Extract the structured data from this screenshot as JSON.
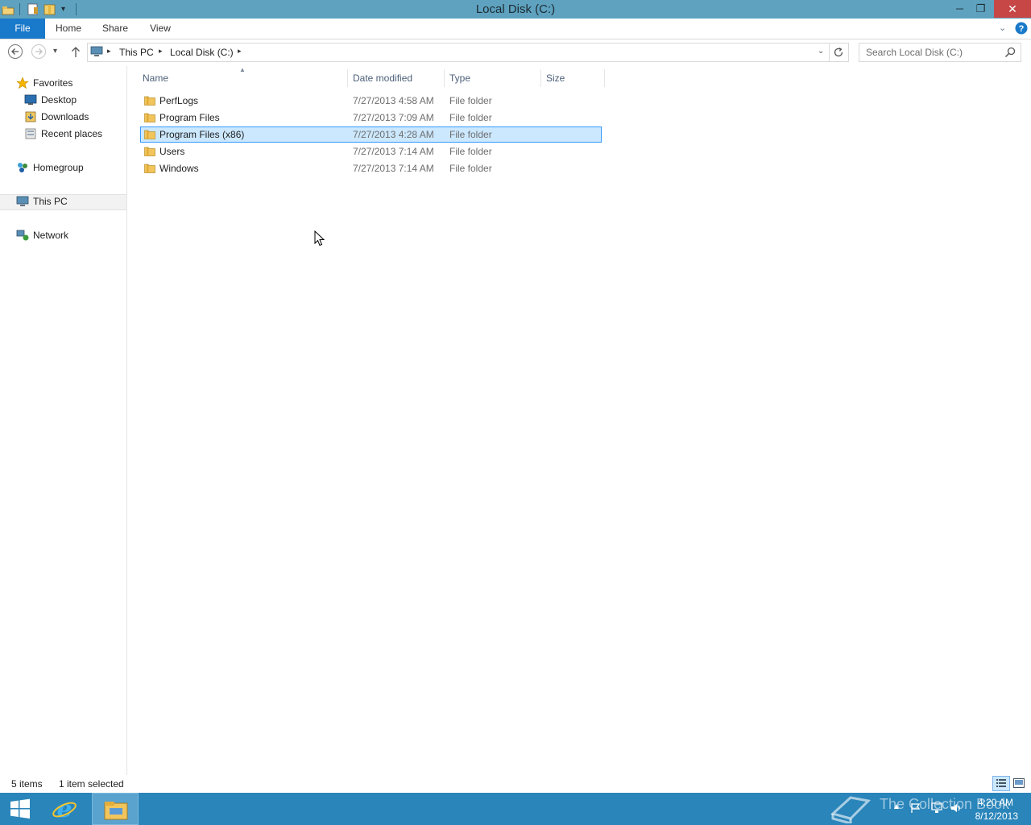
{
  "window": {
    "title": "Local Disk (C:)",
    "minimize_glyph": "─",
    "restore_glyph": "❐",
    "close_glyph": "✕"
  },
  "ribbon": {
    "tabs": [
      "File",
      "Home",
      "Share",
      "View"
    ]
  },
  "address": {
    "breadcrumb": [
      "This PC",
      "Local Disk (C:)"
    ],
    "search_placeholder": "Search Local Disk (C:)"
  },
  "nav": {
    "favorites": "Favorites",
    "favorites_items": [
      "Desktop",
      "Downloads",
      "Recent places"
    ],
    "homegroup": "Homegroup",
    "this_pc": "This PC",
    "network": "Network"
  },
  "columns": {
    "name": "Name",
    "date": "Date modified",
    "type": "Type",
    "size": "Size"
  },
  "files": [
    {
      "name": "PerfLogs",
      "date": "7/27/2013 4:58 AM",
      "type": "File folder",
      "selected": false
    },
    {
      "name": "Program Files",
      "date": "7/27/2013 7:09 AM",
      "type": "File folder",
      "selected": false
    },
    {
      "name": "Program Files (x86)",
      "date": "7/27/2013 4:28 AM",
      "type": "File folder",
      "selected": true
    },
    {
      "name": "Users",
      "date": "7/27/2013 7:14 AM",
      "type": "File folder",
      "selected": false
    },
    {
      "name": "Windows",
      "date": "7/27/2013 7:14 AM",
      "type": "File folder",
      "selected": false
    }
  ],
  "status": {
    "item_count": "5 items",
    "selection": "1 item selected"
  },
  "taskbar": {
    "time": "4:20 AM",
    "date": "8/12/2013",
    "watermark": "The Collection Book"
  },
  "colors": {
    "title_bar": "#5ea2bf",
    "file_tab": "#1979ca",
    "selection_fill": "#cce8ff",
    "selection_border": "#3399ff",
    "taskbar": "#2a85ba",
    "close_button": "#c74646"
  },
  "icons": [
    "folder-icon",
    "star-icon",
    "desktop-icon",
    "downloads-icon",
    "recent-places-icon",
    "homegroup-icon",
    "computer-icon",
    "network-icon",
    "search-icon",
    "refresh-icon",
    "help-icon",
    "back-arrow-icon",
    "forward-arrow-icon",
    "up-arrow-icon",
    "windows-start-icon",
    "internet-explorer-icon",
    "file-explorer-icon"
  ]
}
